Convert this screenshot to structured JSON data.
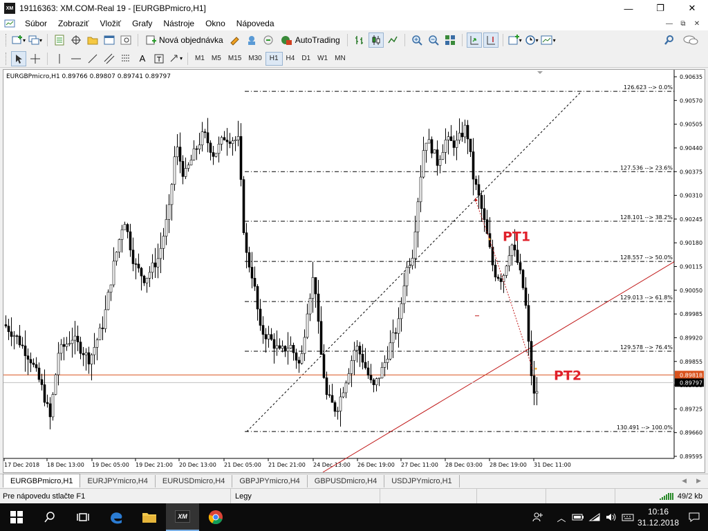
{
  "window": {
    "title": "19116363: XM.COM-Real 19 - [EURGBPmicro,H1]",
    "app_icon_text": "XM",
    "controls": {
      "minimize": "—",
      "maximize": "❐",
      "close": "✕"
    }
  },
  "menu": {
    "items": [
      "Súbor",
      "Zobraziť",
      "Vložiť",
      "Grafy",
      "Nástroje",
      "Okno",
      "Nápoveda"
    ],
    "mdi_controls": [
      "—",
      "⧉",
      "✕"
    ]
  },
  "toolbar1": {
    "new_order_label": "Nová objednávka",
    "autotrading_label": "AutoTrading"
  },
  "toolbar2": {
    "timeframes": [
      "M1",
      "M5",
      "M15",
      "M30",
      "H1",
      "H4",
      "D1",
      "W1",
      "MN"
    ],
    "active_timeframe": "H1"
  },
  "chart": {
    "header": "EURGBPmicro,H1  0.89766 0.89807 0.89741 0.89797",
    "price_labels": [
      "0.90635",
      "0.90570",
      "0.90505",
      "0.90440",
      "0.90375",
      "0.90310",
      "0.90245",
      "0.90180",
      "0.90115",
      "0.90050",
      "0.89985",
      "0.89920",
      "0.89855",
      "0.89790",
      "0.89725",
      "0.89660",
      "0.89595"
    ],
    "bid_price": "0.89818",
    "last_price": "0.89797",
    "time_labels": [
      "17 Dec 2018",
      "18 Dec 13:00",
      "19 Dec 05:00",
      "19 Dec 21:00",
      "20 Dec 13:00",
      "21 Dec 05:00",
      "21 Dec 21:00",
      "24 Dec 13:00",
      "26 Dec 19:00",
      "27 Dec 11:00",
      "28 Dec 03:00",
      "28 Dec 19:00",
      "31 Dec 11:00"
    ],
    "fib_levels": [
      {
        "label": "126.623 --> 0.0%",
        "price": 0.90595
      },
      {
        "label": "127.536 --> 23.6%",
        "price": 0.90375
      },
      {
        "label": "128.101 --> 38.2%",
        "price": 0.90239
      },
      {
        "label": "128.557 --> 50.0%",
        "price": 0.90129
      },
      {
        "label": "129.013 --> 61.8%",
        "price": 0.90019
      },
      {
        "label": "129.578 --> 76.4%",
        "price": 0.89883
      },
      {
        "label": "130.491 --> 100.0%",
        "price": 0.89663
      }
    ],
    "annotations": [
      {
        "text": "PT1",
        "color": "#e0202a"
      },
      {
        "text": "PT2",
        "color": "#e0202a"
      }
    ],
    "colors": {
      "candle": "#000000",
      "bid_line": "#d9531e",
      "trendline": "#c01818",
      "fib_line": "#000000",
      "background": "#ffffff"
    }
  },
  "tabs": [
    "EURGBPmicro,H1",
    "EURJPYmicro,H4",
    "EURUSDmicro,H4",
    "GBPJPYmicro,H4",
    "GBPUSDmicro,H4",
    "USDJPYmicro,H1"
  ],
  "active_tab": "EURGBPmicro,H1",
  "statusbar": {
    "help_text": "Pre nápovedu stlačte F1",
    "profile": "Legy",
    "traffic": "49/2 kb"
  },
  "taskbar": {
    "time": "10:16",
    "date": "31.12.2018"
  }
}
